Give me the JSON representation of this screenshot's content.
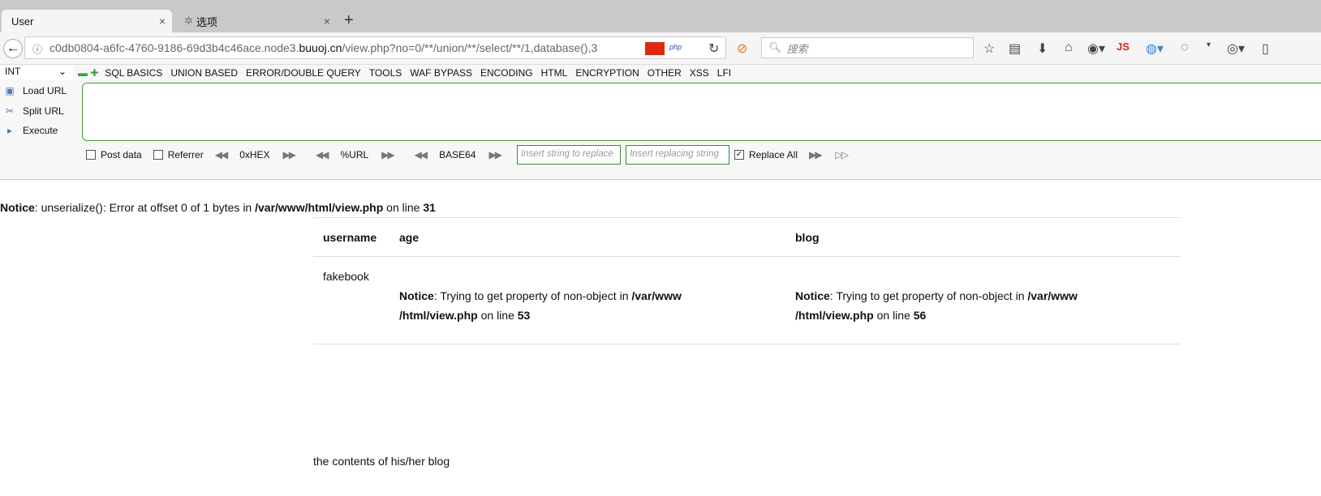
{
  "tabs": [
    {
      "label": "User",
      "close": "×"
    },
    {
      "label": "选项",
      "close": "×"
    }
  ],
  "new_tab": "+",
  "url": {
    "prefix": "c0db0804-a6fc-4760-9186-69d3b4c46ace.node3.",
    "domain": "buuoj.cn",
    "path": "/view.php?no=0/**/union/**/select/**/1,database(),3"
  },
  "search_placeholder": "搜索",
  "toolbar_js": "JS",
  "hackbar": {
    "select": "INT",
    "menus": [
      "SQL BASICS",
      "UNION BASED",
      "ERROR/DOUBLE QUERY",
      "TOOLS",
      "WAF BYPASS",
      "ENCODING",
      "HTML",
      "ENCRYPTION",
      "OTHER",
      "XSS",
      "LFI"
    ],
    "load_url": "Load URL",
    "split_url": "Split URL",
    "execute": "Execute",
    "post_data": "Post data",
    "referrer": "Referrer",
    "hex": "0xHEX",
    "url_enc": "%URL",
    "base64": "BASE64",
    "replace_ph": "Insert string to replace",
    "replacing_ph": "Insert replacing string",
    "replace_all": "Replace All"
  },
  "page": {
    "notice1": {
      "label": "Notice",
      "text": ": unserialize(): Error at offset 0 of 1 bytes in ",
      "file": "/var/www/html/view.php",
      "on": " on line ",
      "line": "31"
    },
    "headers": [
      "username",
      "age",
      "blog"
    ],
    "username": "fakebook",
    "age_notice": {
      "label": "Notice",
      "text": ": Trying to get property of non-object in ",
      "file": "/var/www /html/view.php",
      "on": " on line ",
      "line": "53"
    },
    "blog_notice": {
      "label": "Notice",
      "text": ": Trying to get property of non-object in ",
      "file": "/var/www /html/view.php",
      "on": " on line ",
      "line": "56"
    },
    "footer": "the contents of his/her blog"
  }
}
